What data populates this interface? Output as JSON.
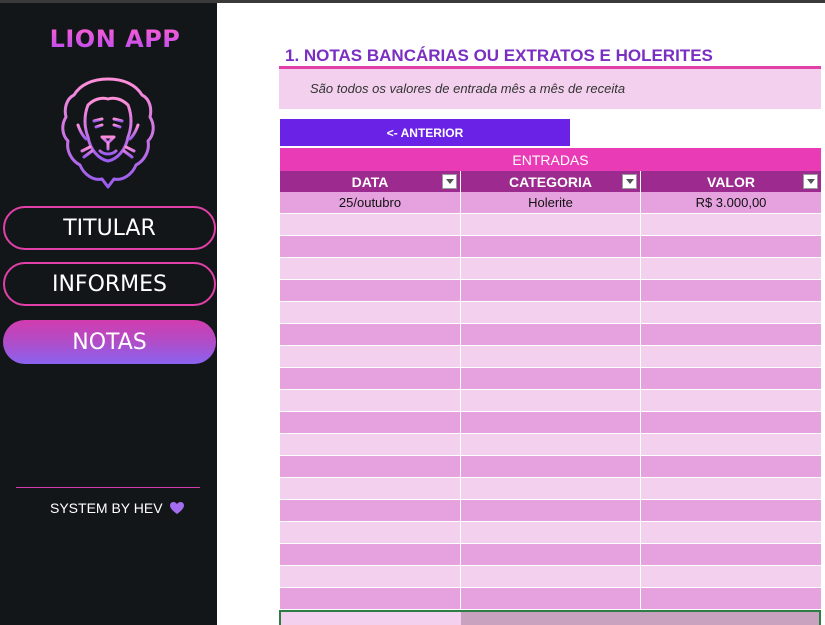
{
  "sidebar": {
    "app_title": "LION APP",
    "logo_icon": "lion-head-icon",
    "nav": [
      {
        "label": "TITULAR",
        "active": false
      },
      {
        "label": "INFORMES",
        "active": false
      },
      {
        "label": "NOTAS",
        "active": true
      }
    ],
    "credit": "SYSTEM BY HEV",
    "credit_icon": "heart-icon"
  },
  "main": {
    "title": "1. NOTAS BANCÁRIAS OU EXTRATOS E HOLERITES",
    "description": "São todos os valores de entrada mês a mês de receita",
    "prev_button": "<- ANTERIOR",
    "table": {
      "caption": "ENTRADAS",
      "columns": [
        "DATA",
        "CATEGORIA",
        "VALOR"
      ],
      "rows": [
        [
          "25/outubro",
          "Holerite",
          "R$ 3.000,00"
        ],
        [
          "",
          "",
          ""
        ],
        [
          "",
          "",
          ""
        ],
        [
          "",
          "",
          ""
        ],
        [
          "",
          "",
          ""
        ],
        [
          "",
          "",
          ""
        ],
        [
          "",
          "",
          ""
        ],
        [
          "",
          "",
          ""
        ],
        [
          "",
          "",
          ""
        ],
        [
          "",
          "",
          ""
        ],
        [
          "",
          "",
          ""
        ],
        [
          "",
          "",
          ""
        ],
        [
          "",
          "",
          ""
        ],
        [
          "",
          "",
          ""
        ],
        [
          "",
          "",
          ""
        ],
        [
          "",
          "",
          ""
        ],
        [
          "",
          "",
          ""
        ],
        [
          "",
          "",
          ""
        ],
        [
          "",
          "",
          ""
        ]
      ]
    }
  },
  "colors": {
    "sidebar_bg": "#121619",
    "accent_pink": "#e040a8",
    "accent_purple": "#6a22e6",
    "title_purple": "#7a2fc2",
    "header_bg": "#9d2a8e",
    "caption_bg": "#ea3bb7"
  }
}
